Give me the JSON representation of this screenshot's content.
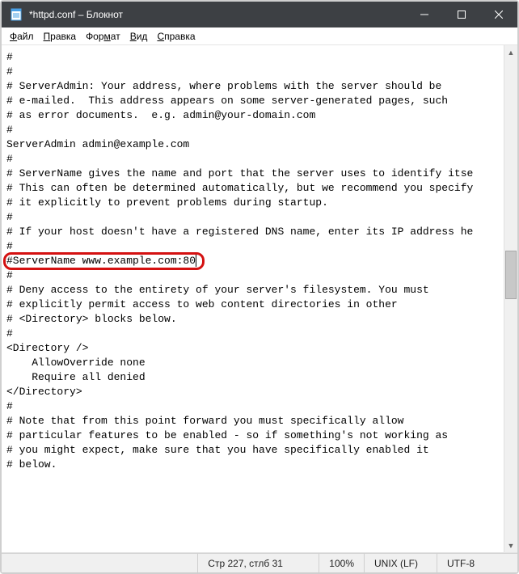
{
  "window": {
    "title": "*httpd.conf – Блокнот"
  },
  "menu": {
    "file": {
      "first": "Ф",
      "rest": "айл"
    },
    "edit": {
      "first": "П",
      "rest": "равка"
    },
    "format": {
      "first": "Фор",
      "u": "м",
      "rest": "ат"
    },
    "view": {
      "first": "",
      "u": "В",
      "rest": "ид"
    },
    "help": {
      "first": "",
      "u": "С",
      "rest": "правка"
    }
  },
  "content": {
    "lines": [
      "#",
      "",
      "#",
      "# ServerAdmin: Your address, where problems with the server should be",
      "# e-mailed.  This address appears on some server-generated pages, such",
      "# as error documents.  e.g. admin@your-domain.com",
      "#",
      "ServerAdmin admin@example.com",
      "",
      "#",
      "# ServerName gives the name and port that the server uses to identify itse",
      "# This can often be determined automatically, but we recommend you specify",
      "# it explicitly to prevent problems during startup.",
      "#",
      "# If your host doesn't have a registered DNS name, enter its IP address he",
      "#"
    ],
    "highlighted_line": "#ServerName www.example.com:80",
    "lines_after": [
      "",
      "#",
      "# Deny access to the entirety of your server's filesystem. You must",
      "# explicitly permit access to web content directories in other",
      "# <Directory> blocks below.",
      "#",
      "<Directory />",
      "    AllowOverride none",
      "    Require all denied",
      "</Directory>",
      "",
      "#",
      "# Note that from this point forward you must specifically allow",
      "# particular features to be enabled - so if something's not working as",
      "# you might expect, make sure that you have specifically enabled it",
      "# below."
    ]
  },
  "status": {
    "cursor": "Стр 227, стлб 31",
    "zoom": "100%",
    "eol": "UNIX (LF)",
    "encoding": "UTF-8"
  }
}
